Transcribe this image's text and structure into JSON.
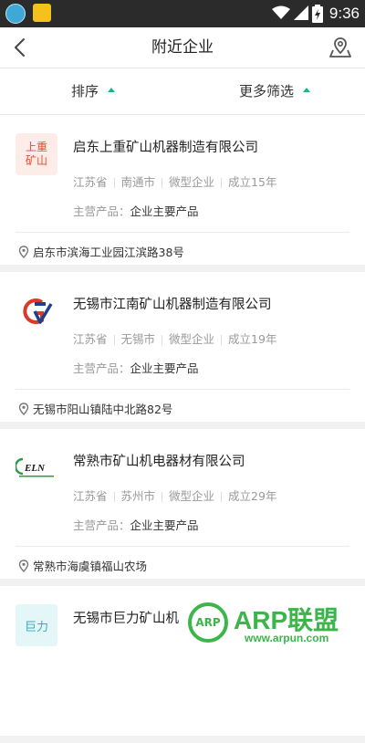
{
  "status_bar": {
    "time": "9:36",
    "icons": [
      "app-icon-1",
      "app-icon-2",
      "wifi-icon",
      "signal-icon",
      "battery-charging-icon"
    ]
  },
  "header": {
    "title": "附近企业",
    "back_icon": "chevron-left-icon",
    "location_icon": "map-location-icon"
  },
  "filter": {
    "sort_label": "排序",
    "more_label": "更多筛选",
    "accent": "#1ab394"
  },
  "companies": [
    {
      "logo_text": [
        "上重",
        "矿山"
      ],
      "name": "启东上重矿山机器制造有限公司",
      "province": "江苏省",
      "city": "南通市",
      "size": "微型企业",
      "founded": "成立15年",
      "product_label": "主营产品：",
      "product": "企业主要产品",
      "address": "启东市滨海工业园江滨路38号"
    },
    {
      "logo_text": [],
      "name": "无锡市江南矿山机器制造有限公司",
      "province": "江苏省",
      "city": "无锡市",
      "size": "微型企业",
      "founded": "成立19年",
      "product_label": "主营产品：",
      "product": "企业主要产品",
      "address": "无锡市阳山镇陆中北路82号"
    },
    {
      "logo_text": [],
      "name": "常熟市矿山机电器材有限公司",
      "province": "江苏省",
      "city": "苏州市",
      "size": "微型企业",
      "founded": "成立29年",
      "product_label": "主营产品：",
      "product": "企业主要产品",
      "address": "常熟市海虞镇福山农场"
    },
    {
      "logo_text": [
        "巨力"
      ],
      "name": "无锡市巨力矿山机"
    }
  ],
  "watermark": {
    "circle": "ARP",
    "brand": "ARP联盟",
    "url": "www.arpun.com"
  }
}
